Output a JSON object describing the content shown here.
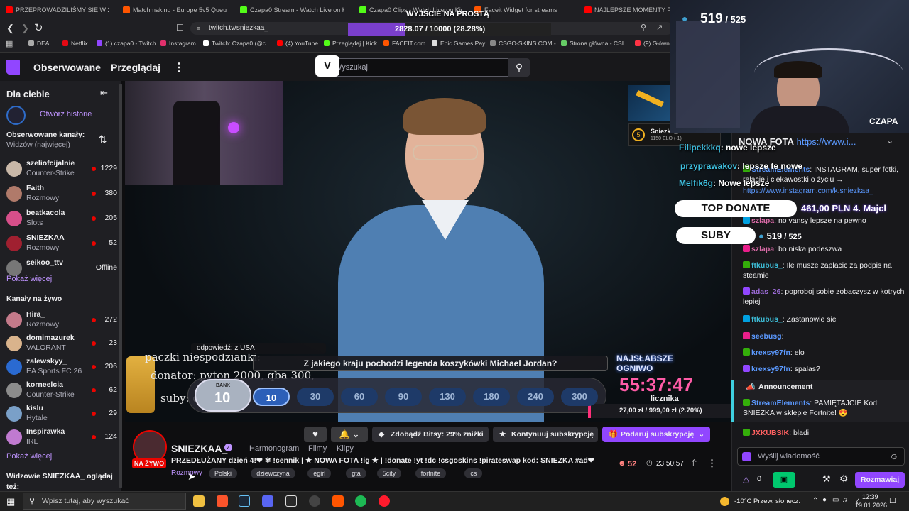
{
  "browser": {
    "tabs": [
      {
        "title": "PRZEPROWADZILIŚMY SIĘ W 24...",
        "color": "#ff0000"
      },
      {
        "title": "Matchmaking - Europe 5v5 Queue -",
        "color": "#ff5500"
      },
      {
        "title": "Czapa0 Stream - Watch Live on Kick",
        "color": "#53fc18"
      },
      {
        "title": "Czapa0 Clips - Watch Live on Kick",
        "color": "#53fc18"
      },
      {
        "title": "Faceit Widget for streams",
        "color": "#ff5500"
      },
      {
        "title": "NAJLEPSZE MOMENTY POLSK",
        "color": "#ff0000"
      }
    ],
    "url": "twitch.tv/sniezkaa_",
    "bookmarks": [
      {
        "label": "DEAL",
        "color": "#aaaaaa"
      },
      {
        "label": "Netflix",
        "color": "#e50914"
      },
      {
        "label": "(1) czapa0 - Twitch",
        "color": "#9146ff"
      },
      {
        "label": "Instagram",
        "color": "#e1306c"
      },
      {
        "label": "Twitch: Czapa0 (@c...",
        "color": "#ffffff"
      },
      {
        "label": "(4) YouTube",
        "color": "#ff0000"
      },
      {
        "label": "Przeglądaj | Kick",
        "color": "#53fc18"
      },
      {
        "label": "FACEIT.com",
        "color": "#ff5500"
      },
      {
        "label": "Epic Games Pay",
        "color": "#dddddd"
      },
      {
        "label": "CSGO-SKINS.COM -...",
        "color": "#888888"
      },
      {
        "label": "Strona główna - CSI...",
        "color": "#66cc66"
      },
      {
        "label": "(9) Główne",
        "color": "#ff3344"
      }
    ]
  },
  "overlay": {
    "goal_title": "WYJŚCIE NA PROSTĄ",
    "goal_value": "2828.07 / 10000 (28.28%)",
    "goal_progress": 0.2828,
    "subs_current": "519",
    "subs_total": "525",
    "cam_label": "CZAPA",
    "top_donate_label": "TOP DONATE",
    "top_donate_value": "461,00 PLN 4. Majcl",
    "suby_label": "SUBY",
    "suby_value": "519",
    "suby_total": "525",
    "float_chat": [
      {
        "user": "Filipekkkq",
        "text": "nowe lepsze"
      },
      {
        "user": "przyprawakov",
        "text": "lepsze te nowe"
      },
      {
        "user": "Melfik6g",
        "text": "Nowe lepsze"
      }
    ]
  },
  "twitch": {
    "nav": {
      "following": "Obserwowane",
      "browse": "Przeglądaj",
      "search_placeholder": "Wyszukaj"
    },
    "sidebar": {
      "for_you": "Dla ciebie",
      "open_stories": "Otwórz historie",
      "followed_heading": "Obserwowane kanały:",
      "followed_sort": "Widzów (najwięcej)",
      "followed": [
        {
          "name": "szeliofcijalnie",
          "game": "Counter-Strike",
          "viewers": "1229",
          "live": true,
          "color": "#c9b8a8"
        },
        {
          "name": "Faith",
          "game": "Rozmowy",
          "viewers": "380",
          "live": true,
          "color": "#b07a6a"
        },
        {
          "name": "beatkacola",
          "game": "Slots",
          "viewers": "205",
          "live": true,
          "color": "#d64f8a"
        },
        {
          "name": "SNIEZKAA_",
          "game": "Rozmowy",
          "viewers": "52",
          "live": true,
          "color": "#a02030"
        },
        {
          "name": "seikoo_ttv",
          "game": "",
          "viewers": "Offline",
          "live": false,
          "color": "#777777"
        }
      ],
      "show_more_1": "Pokaż więcej",
      "live_heading": "Kanały na żywo",
      "live": [
        {
          "name": "Hira_",
          "game": "Rozmowy",
          "viewers": "272",
          "color": "#c47a8a"
        },
        {
          "name": "domimazurek",
          "game": "VALORANT",
          "viewers": "23",
          "color": "#d9b38c"
        },
        {
          "name": "zalewskyy_",
          "game": "EA Sports FC 26",
          "viewers": "206",
          "color": "#2a6ad1"
        },
        {
          "name": "korneelcia",
          "game": "Counter-Strike",
          "viewers": "62",
          "color": "#8c8c8c"
        },
        {
          "name": "kislu",
          "game": "Hytale",
          "viewers": "29",
          "color": "#7aa0c8"
        },
        {
          "name": "Inspirawka",
          "game": "IRL",
          "viewers": "124",
          "color": "#c07ad0"
        }
      ],
      "show_more_2": "Pokaż więcej",
      "also_watch": "Widzowie SNIEZKAA_ oglądaj",
      "also_watch_2": "też:"
    },
    "video": {
      "reply_label": "odpowiedź: z USA",
      "question": "Z jakiego kraju pochodzi legenda koszykówki Michael Jordan?",
      "bank_label": "BANK",
      "bank_value": "10",
      "values": [
        "10",
        "30",
        "60",
        "90",
        "130",
        "180",
        "240",
        "300"
      ],
      "left_text_1": "paczki niespodzianki:",
      "left_text_2": "donator: pyton 2000, qba 300,",
      "left_text_3": "suby: qba 10",
      "timer": "55:37:47",
      "subathon_label": "NAJSŁABSZE OGNIWO",
      "counter_label": "licznika",
      "money": "27,00 zł / 999,00 zł (2.70%)",
      "csgo_name": "Sniezka_",
      "csgo_elo": "1150 ELO (-1)"
    },
    "channel": {
      "name": "SNIEZKAA_",
      "live_badge": "NA ŻYWO",
      "tabs": [
        "Harmonogram",
        "Filmy",
        "Klipy"
      ],
      "title": "PRZEDŁUŻANY dzień 4!❤ ❄ !cennik | ★ NOWA FOTA !ig ★ | !donate !yt !dc !csgoskins !pirateswap kod: SNIEZKA #ad❤",
      "category": "Rozmowy",
      "tags": [
        "Polski",
        "dziewczyna",
        "egirl",
        "gta",
        "5city",
        "fortnite",
        "cs"
      ],
      "viewers": "52",
      "uptime": "23:50:57",
      "bits_button": "Zdobądź Bitsy: 29% zniżki",
      "continue_sub": "Kontynuuj subskrypcję",
      "gift_sub": "Podaruj subskrypcję"
    },
    "chat": {
      "pinned_title": "NOWA FOTA",
      "pinned_link": "https://www.i...",
      "messages": [
        {
          "user": "StreamElements",
          "text": ": INSTAGRAM, super fotki, relacje i ciekawostki o życiu →",
          "color": "#5b99ff"
        },
        {
          "user": "",
          "text": "https://www.instagram.com/k.sniezkaa_",
          "color": "#5b99ff"
        },
        {
          "user": "szlapa",
          "text": ": no vansy lepsze na pewno",
          "color": "#d96ba7"
        },
        {
          "user": "szlapa",
          "text": ": bo niska podeszwa",
          "color": "#d96ba7"
        },
        {
          "user": "ftkubus_",
          "text": ": Ile musze zaplacic za podpis na steamie",
          "color": "#3dbcd6"
        },
        {
          "user": "adas_26",
          "text": ": poproboj sobie zobaczysz w kotrych lepiej",
          "color": "#9b6bd6"
        },
        {
          "user": "ftkubus_",
          "text": ": Zastanowie sie",
          "color": "#3dbcd6"
        },
        {
          "user": "seebusg",
          "text": ":",
          "color": "#5b99ff"
        },
        {
          "user": "krexsy97fn",
          "text": ": elo",
          "color": "#5b99ff"
        },
        {
          "user": "krexsy97fn",
          "text": ": spalas?",
          "color": "#5b99ff"
        }
      ],
      "announcement_label": "Announcement",
      "announcement_user": "StreamElements",
      "announcement_text": ": PAMIĘTAJCIE Kod: SNIEZKA w sklepie Fortnite! 😍",
      "last_user": "JXKUBSIK",
      "last_text": ": bladi",
      "input_placeholder": "Wyślij wiadomość",
      "points": "0",
      "send_button": "Rozmawiaj"
    }
  },
  "taskbar": {
    "search_placeholder": "Wpisz tutaj, aby wyszukać",
    "weather": "-10°C  Przew. słonecz.",
    "time": "12:39",
    "date": "19.01.2026"
  }
}
